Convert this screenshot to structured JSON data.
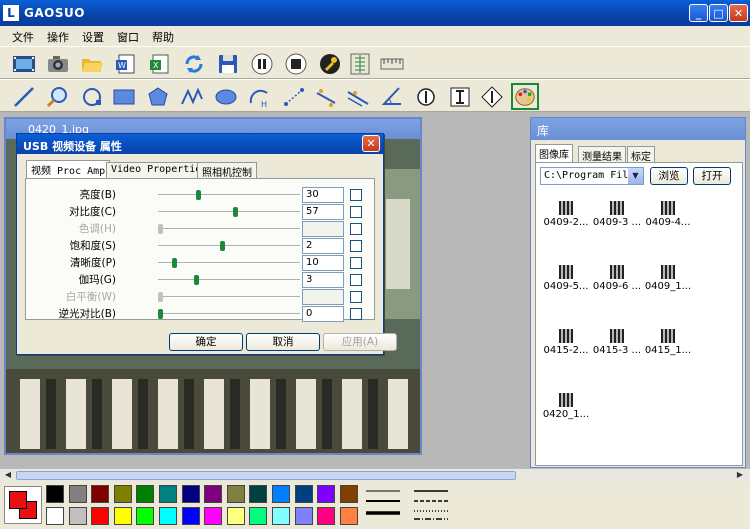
{
  "window": {
    "title": "GAOSUO",
    "minimize": "_",
    "maximize": "□",
    "close": "✕"
  },
  "menu": [
    "文件",
    "操作",
    "设置",
    "窗口",
    "帮助"
  ],
  "toolbar1": [
    "film-icon",
    "camera-icon",
    "open-folder-icon",
    "word-doc-icon",
    "excel-doc-icon",
    "refresh-icon",
    "save-icon",
    "pause-icon",
    "stop-icon",
    "wrench-icon",
    "ruler-vertical-icon",
    "ruler-horizontal-icon"
  ],
  "toolbar2": [
    "line-icon",
    "magnifier-icon",
    "circle-3pt-icon",
    "rectangle-icon",
    "polygon-icon",
    "polyline-icon",
    "ellipse-icon",
    "arc-icon",
    "point-distance-icon",
    "angle-line-icon",
    "parallel-lines-icon",
    "angle-icon",
    "circle-center-icon",
    "vertical-distance-icon",
    "horizontal-distance-icon",
    "palette-icon"
  ],
  "image_window": {
    "title": "0420_1.jpg"
  },
  "dialog": {
    "title": "USB 视频设备 属性",
    "tabs": [
      "视频 Proc Amp",
      "Video Properties",
      "照相机控制"
    ],
    "properties": [
      {
        "label": "亮度(B)",
        "value": "30",
        "pos": 0.28,
        "disabled": false
      },
      {
        "label": "对比度(C)",
        "value": "57",
        "pos": 0.55,
        "disabled": false
      },
      {
        "label": "色调(H)",
        "value": "",
        "pos": 0.0,
        "disabled": true
      },
      {
        "label": "饱和度(S)",
        "value": "2",
        "pos": 0.45,
        "disabled": false
      },
      {
        "label": "清晰度(P)",
        "value": "10",
        "pos": 0.1,
        "disabled": false
      },
      {
        "label": "伽玛(G)",
        "value": "3",
        "pos": 0.26,
        "disabled": false
      },
      {
        "label": "白平衡(W)",
        "value": "",
        "pos": 0.0,
        "disabled": true
      },
      {
        "label": "逆光对比(B)",
        "value": "0",
        "pos": 0.0,
        "disabled": false
      }
    ],
    "ok": "确定",
    "cancel": "取消",
    "apply": "应用(A)"
  },
  "library": {
    "title": "库",
    "tabs": [
      "图像库",
      "测量结果",
      "标定"
    ],
    "path": "C:\\Program Files",
    "browse": "浏览",
    "open": "打开",
    "thumbnails": [
      "0409-2...",
      "0409-3 ...",
      "0409-4...",
      "0409-5...",
      "0409-6 ...",
      "0409_1...",
      "0415-2...",
      "0415-3 ...",
      "0415_1...",
      "0420_1..."
    ]
  },
  "palette": {
    "fg": "#e81010",
    "bg": "#e81010",
    "row1": [
      "#000000",
      "#808080",
      "#800000",
      "#808000",
      "#008000",
      "#008080",
      "#000080",
      "#800080",
      "#808040",
      "#004040",
      "#0080ff",
      "#004080",
      "#8000ff",
      "#804000"
    ],
    "row2": [
      "#ffffff",
      "#c0c0c0",
      "#ff0000",
      "#ffff00",
      "#00ff00",
      "#00ffff",
      "#0000ff",
      "#ff00ff",
      "#ffff80",
      "#00ff80",
      "#80ffff",
      "#8080ff",
      "#ff0080",
      "#ff8040"
    ]
  }
}
